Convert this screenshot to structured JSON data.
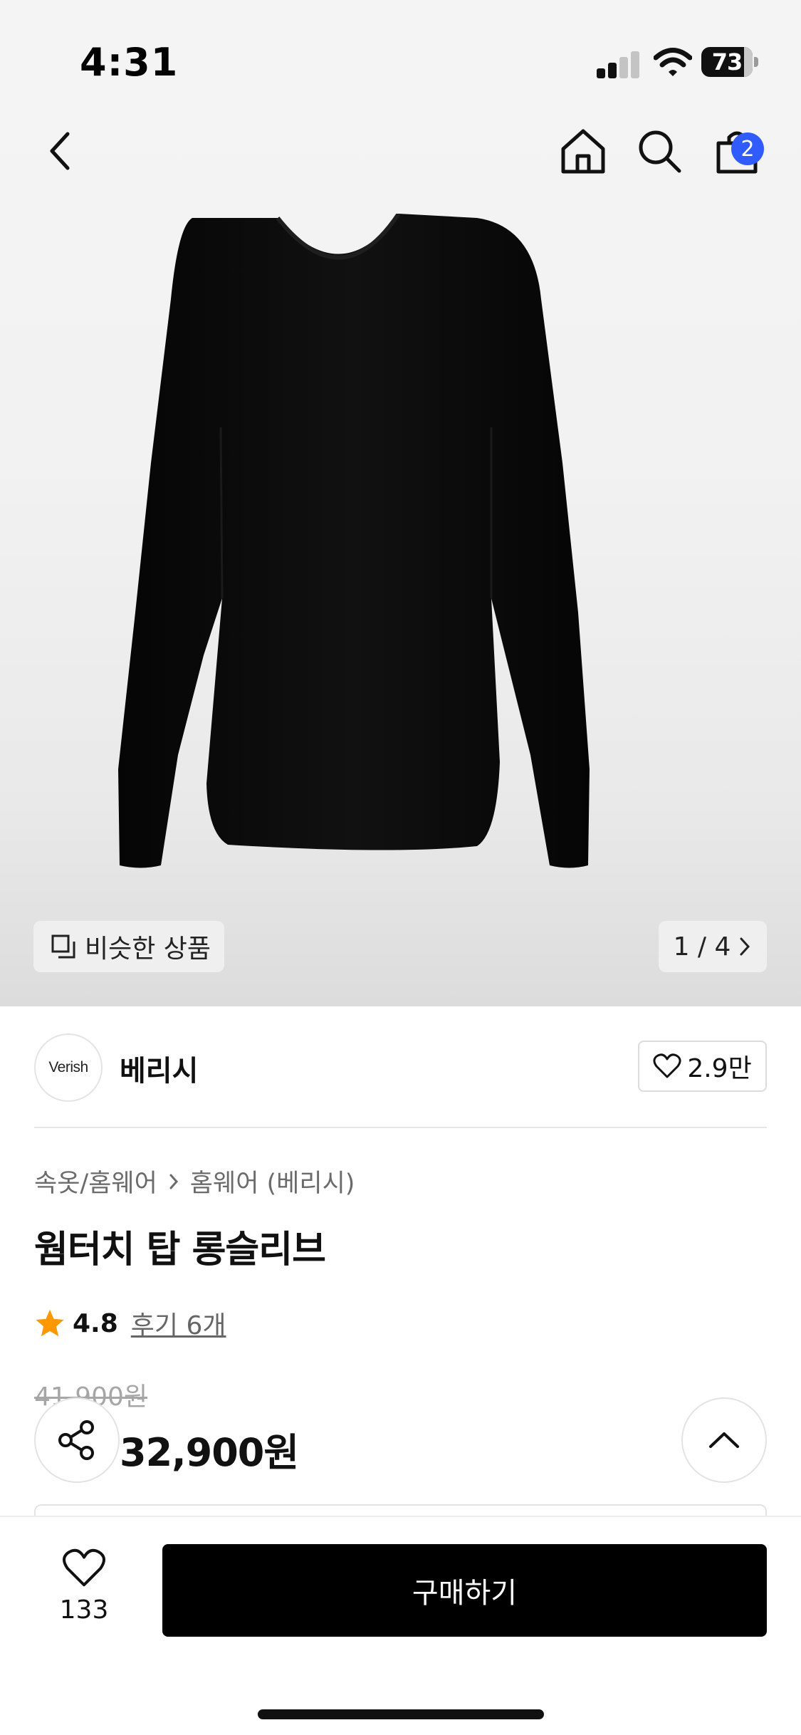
{
  "status_bar": {
    "time": "4:31",
    "battery": "73"
  },
  "nav": {
    "cart_count": "2"
  },
  "gallery": {
    "similar_label": "비슷한 상품",
    "pager": "1 / 4"
  },
  "brand": {
    "logo_text": "Verish",
    "name": "베리시",
    "likes": "2.9만"
  },
  "product": {
    "breadcrumb": [
      "속옷/홈웨어",
      "홈웨어 (베리시)"
    ],
    "title": "웜터치 탑 롱슬리브",
    "rating": "4.8",
    "reviews": "후기 6개",
    "original_price": "41,900원",
    "sale_price": "32,900원"
  },
  "bottom": {
    "wish_count": "133",
    "buy_label": "구매하기"
  },
  "colors": {
    "accent": "#2f5bff",
    "star": "#ff9800",
    "primary": "#000000"
  }
}
